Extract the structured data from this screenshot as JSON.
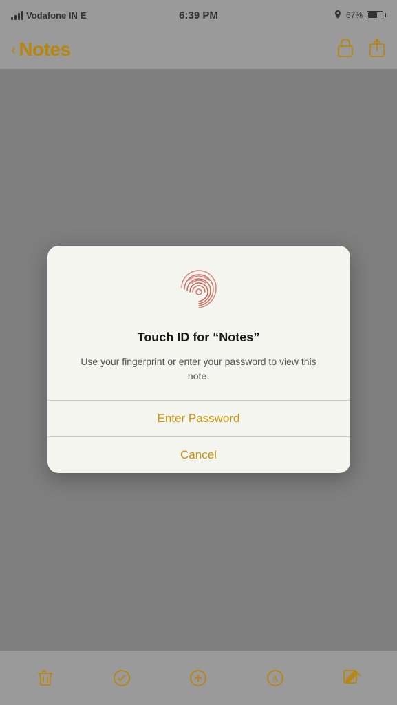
{
  "statusBar": {
    "carrier": "Vodafone IN",
    "network": "E",
    "time": "6:39 PM",
    "batteryPercent": "67%"
  },
  "navBar": {
    "backLabel": "Notes",
    "lockIconName": "lock-icon",
    "shareIconName": "share-icon"
  },
  "dialog": {
    "titleText": "Touch ID for “Notes”",
    "messageText": "Use your fingerprint or enter your password to view this note.",
    "enterPasswordLabel": "Enter Password",
    "cancelLabel": "Cancel",
    "fingerprintIconName": "fingerprint-icon"
  },
  "bottomToolbar": {
    "trashIconName": "trash-icon",
    "checkIconName": "check-icon",
    "addIconName": "add-icon",
    "pencilIconName": "pencil-icon",
    "composeIconName": "compose-icon"
  },
  "colors": {
    "accent": "#b8860b",
    "dialogButton": "#c8960c",
    "background": "#9a9a9a"
  }
}
